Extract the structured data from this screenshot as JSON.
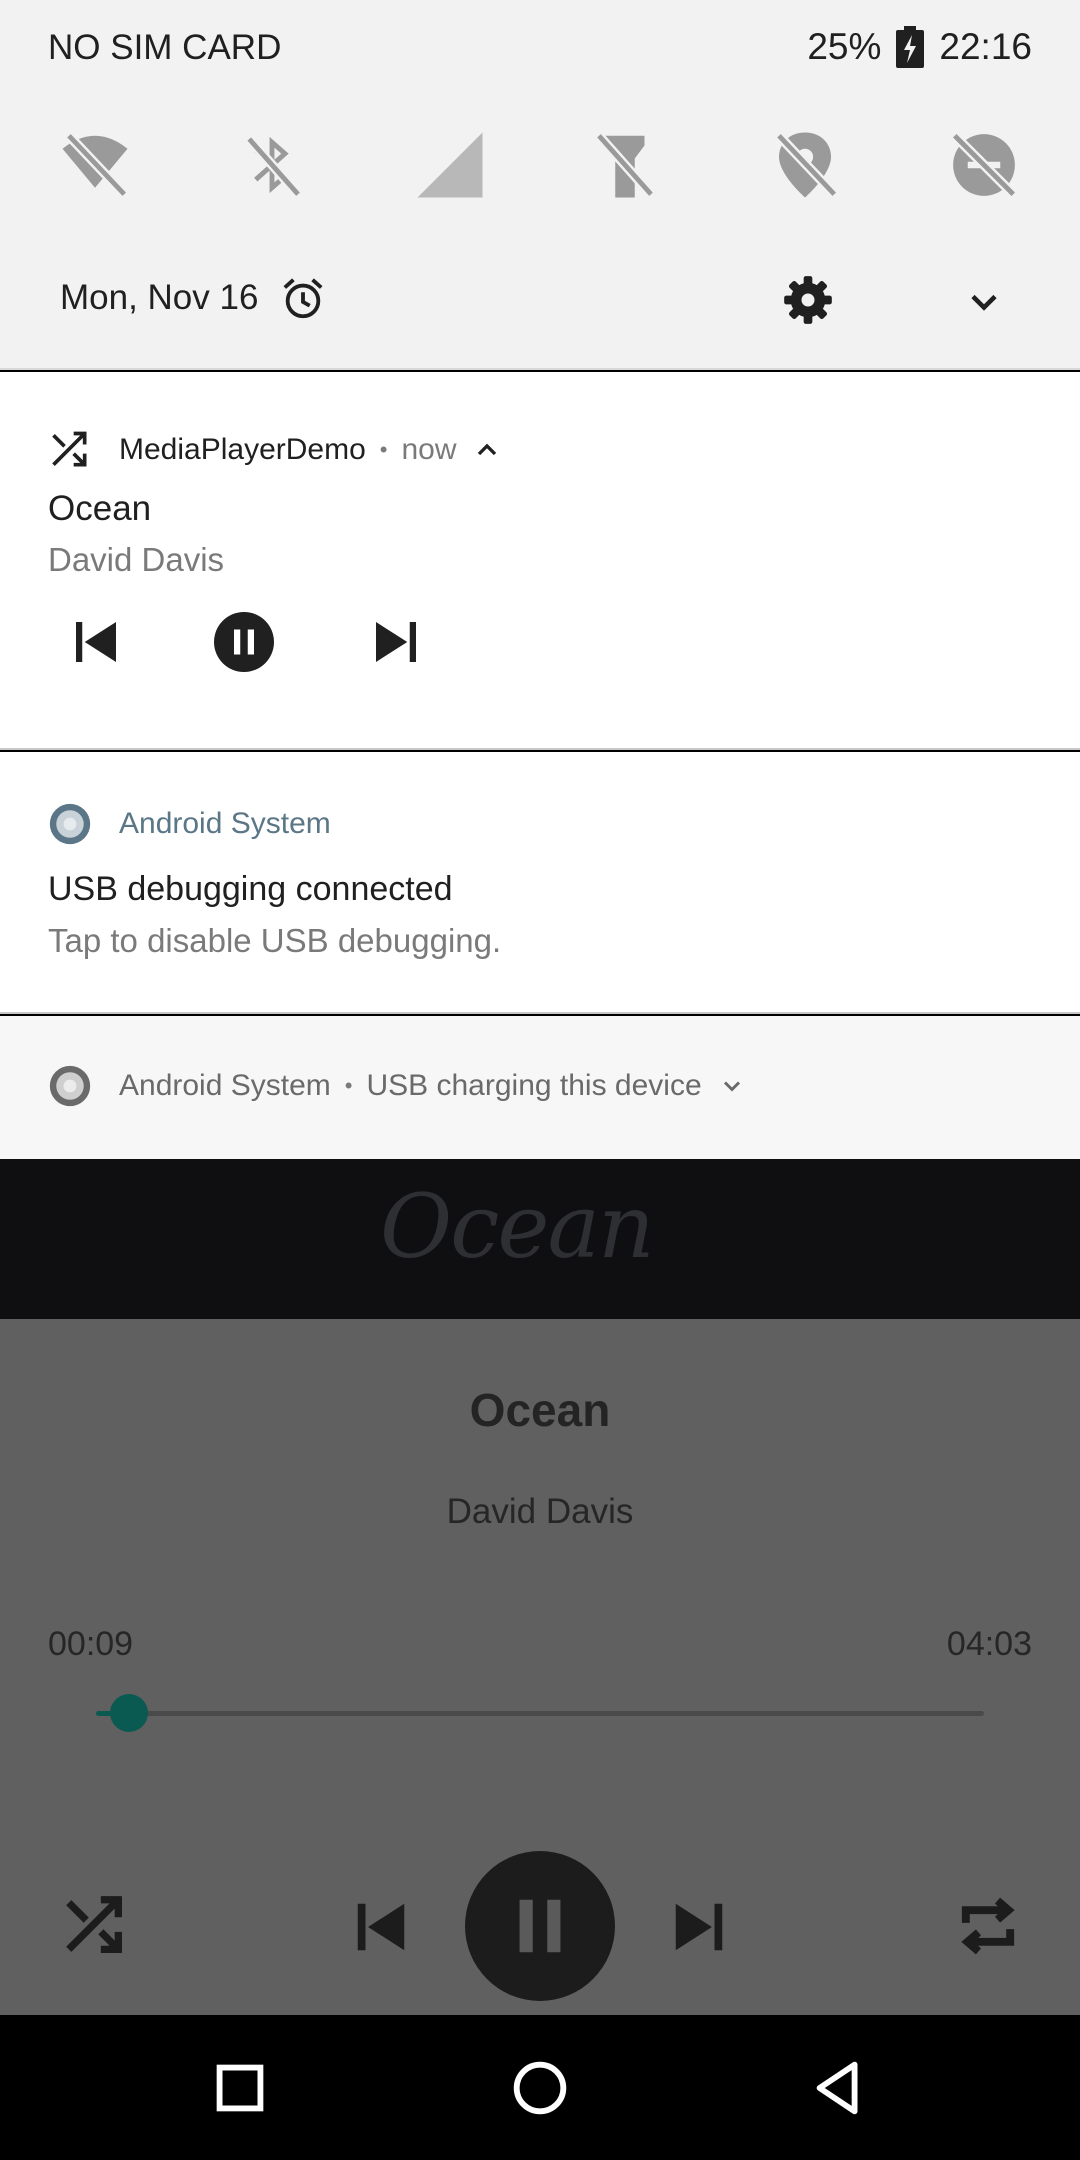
{
  "status_bar": {
    "carrier": "NO SIM CARD",
    "battery": "25%",
    "time": "22:16"
  },
  "quick_settings": {
    "tiles": [
      "wifi-off-icon",
      "bluetooth-off-icon",
      "signal-icon",
      "flashlight-off-icon",
      "location-off-icon",
      "data-saver-off-icon"
    ],
    "date": "Mon, Nov 16"
  },
  "media_notification": {
    "app": "MediaPlayerDemo",
    "time": "now",
    "title": "Ocean",
    "artist": "David Davis"
  },
  "usb_notification": {
    "app": "Android System",
    "title": "USB debugging connected",
    "text": "Tap to disable USB debugging."
  },
  "charging_notification": {
    "app": "Android System",
    "text": "USB charging this device"
  },
  "player": {
    "album_art_text": "Ocean",
    "title": "Ocean",
    "artist": "David Davis",
    "elapsed": "00:09",
    "duration": "04:03",
    "progress": 0.037
  },
  "colors": {
    "accent": "#0a5a52",
    "shade_bg": "#f2f2f2",
    "scrim_bg": "#606060"
  }
}
